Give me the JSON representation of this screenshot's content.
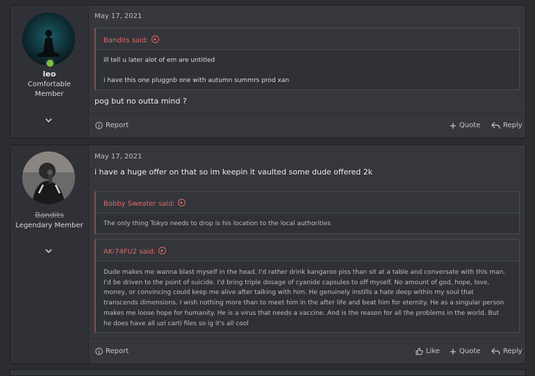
{
  "posts": [
    {
      "user": {
        "name": "leo",
        "title_line1": "Comfortable",
        "title_line2": "Member"
      },
      "date": "May 17, 2021",
      "quotes": [
        {
          "author": "Bandits said:",
          "lines": [
            "ill tell u later alot of em are untitled",
            "i have this one pluggnb one with autumn summrs prod xan"
          ]
        }
      ],
      "text": "pog but no outta mind ?",
      "actions": {
        "report": "Report",
        "quote": "Quote",
        "reply": "Reply"
      }
    },
    {
      "user": {
        "name": "Bandits",
        "title_line1": "Legendary Member"
      },
      "date": "May 17, 2021",
      "text": "i have a huge offer on that so im keepin it vaulted some dude offered 2k",
      "quotes": [
        {
          "author": "Bobby Sweater said:",
          "lines": [
            "The only thing Tokyo needs to drop is his location to the local authorities"
          ]
        },
        {
          "author": "AK-74FU2 said:",
          "lines": [
            "Dude makes me wanna blast myself in the head. I'd rather drink kangaroo piss than sit at a table and conversate with this man.",
            "I'd be driven to the point of suicide. I'd bring triple dosage of cyanide capsules to off myself. No amount of god, hope, love,",
            "money, or convincing could keep me alive after talking with him. He genuinely instills a hate deep within my soul that",
            "transcends dimensions. I wish nothing more than to meet him in the after life and beat him for eternity. He as a singular person",
            "makes me loose hope for humanity. He is a virus that needs a vaccine. And is the reason for all the problems in the world. But",
            "he does have all uzi carti files so ig it's all cool"
          ]
        }
      ],
      "actions": {
        "report": "Report",
        "like": "Like",
        "quote": "Quote",
        "reply": "Reply"
      }
    }
  ],
  "icons": {
    "report": "info-circle-icon",
    "quote": "plus-icon",
    "reply": "reply-arrow-icon",
    "like": "thumbs-up-icon",
    "expand": "chevron-down-icon",
    "quote_jump": "arrow-up-circle-icon",
    "online": "online-dot-icon"
  },
  "colors": {
    "background": "#2b2d31",
    "post": "#35373c",
    "quote_author": "#e06a6a",
    "online": "#7bc043"
  }
}
